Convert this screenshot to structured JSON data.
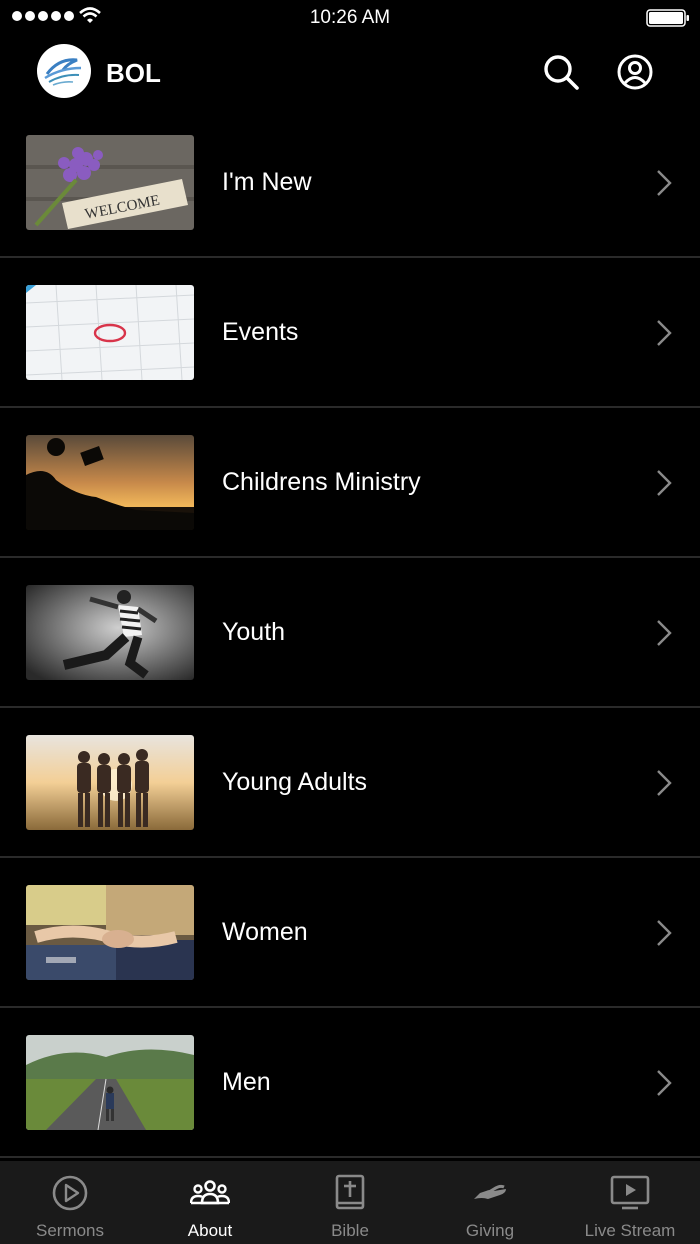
{
  "status_bar": {
    "time": "10:26 AM"
  },
  "header": {
    "title": "BOL"
  },
  "menu": {
    "items": [
      {
        "label": "I'm New"
      },
      {
        "label": "Events"
      },
      {
        "label": "Childrens Ministry"
      },
      {
        "label": "Youth"
      },
      {
        "label": "Young Adults"
      },
      {
        "label": "Women"
      },
      {
        "label": "Men"
      }
    ],
    "welcome_tag_text": "WELCOME"
  },
  "tabbar": {
    "tabs": [
      {
        "label": "Sermons",
        "icon": "play-circle-icon"
      },
      {
        "label": "About",
        "icon": "people-group-icon",
        "active": true
      },
      {
        "label": "Bible",
        "icon": "bible-icon"
      },
      {
        "label": "Giving",
        "icon": "giving-hand-icon"
      },
      {
        "label": "Live Stream",
        "icon": "live-stream-icon"
      }
    ]
  }
}
